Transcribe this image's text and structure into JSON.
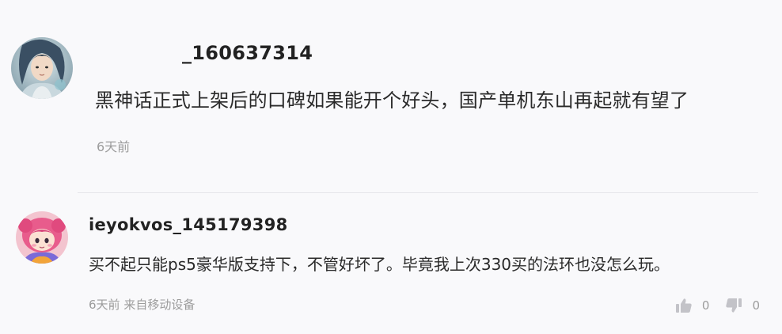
{
  "comments": [
    {
      "username": "_160637314",
      "text": "黑神话正式上架后的口碑如果能开个好头，国产单机东山再起就有望了",
      "time": "6天前",
      "avatar_icon": "avatar-anime-character"
    },
    {
      "username": "ieyokvos_145179398",
      "text": "买不起只能ps5豪华版支持下，不管好坏了。毕竟我上次330买的法环也没怎么玩。",
      "time": "6天前",
      "source": "来自移动设备",
      "avatar_icon": "avatar-cartoon-girl",
      "likes": "0",
      "dislikes": "0",
      "like_icon": "thumbs-up-icon",
      "dislike_icon": "thumbs-down-icon"
    }
  ],
  "colors": {
    "background": "#f9f9fb",
    "username": "#222222",
    "text": "#2a2a2a",
    "meta": "#9c9c9c",
    "icon": "#c3c3c8"
  }
}
